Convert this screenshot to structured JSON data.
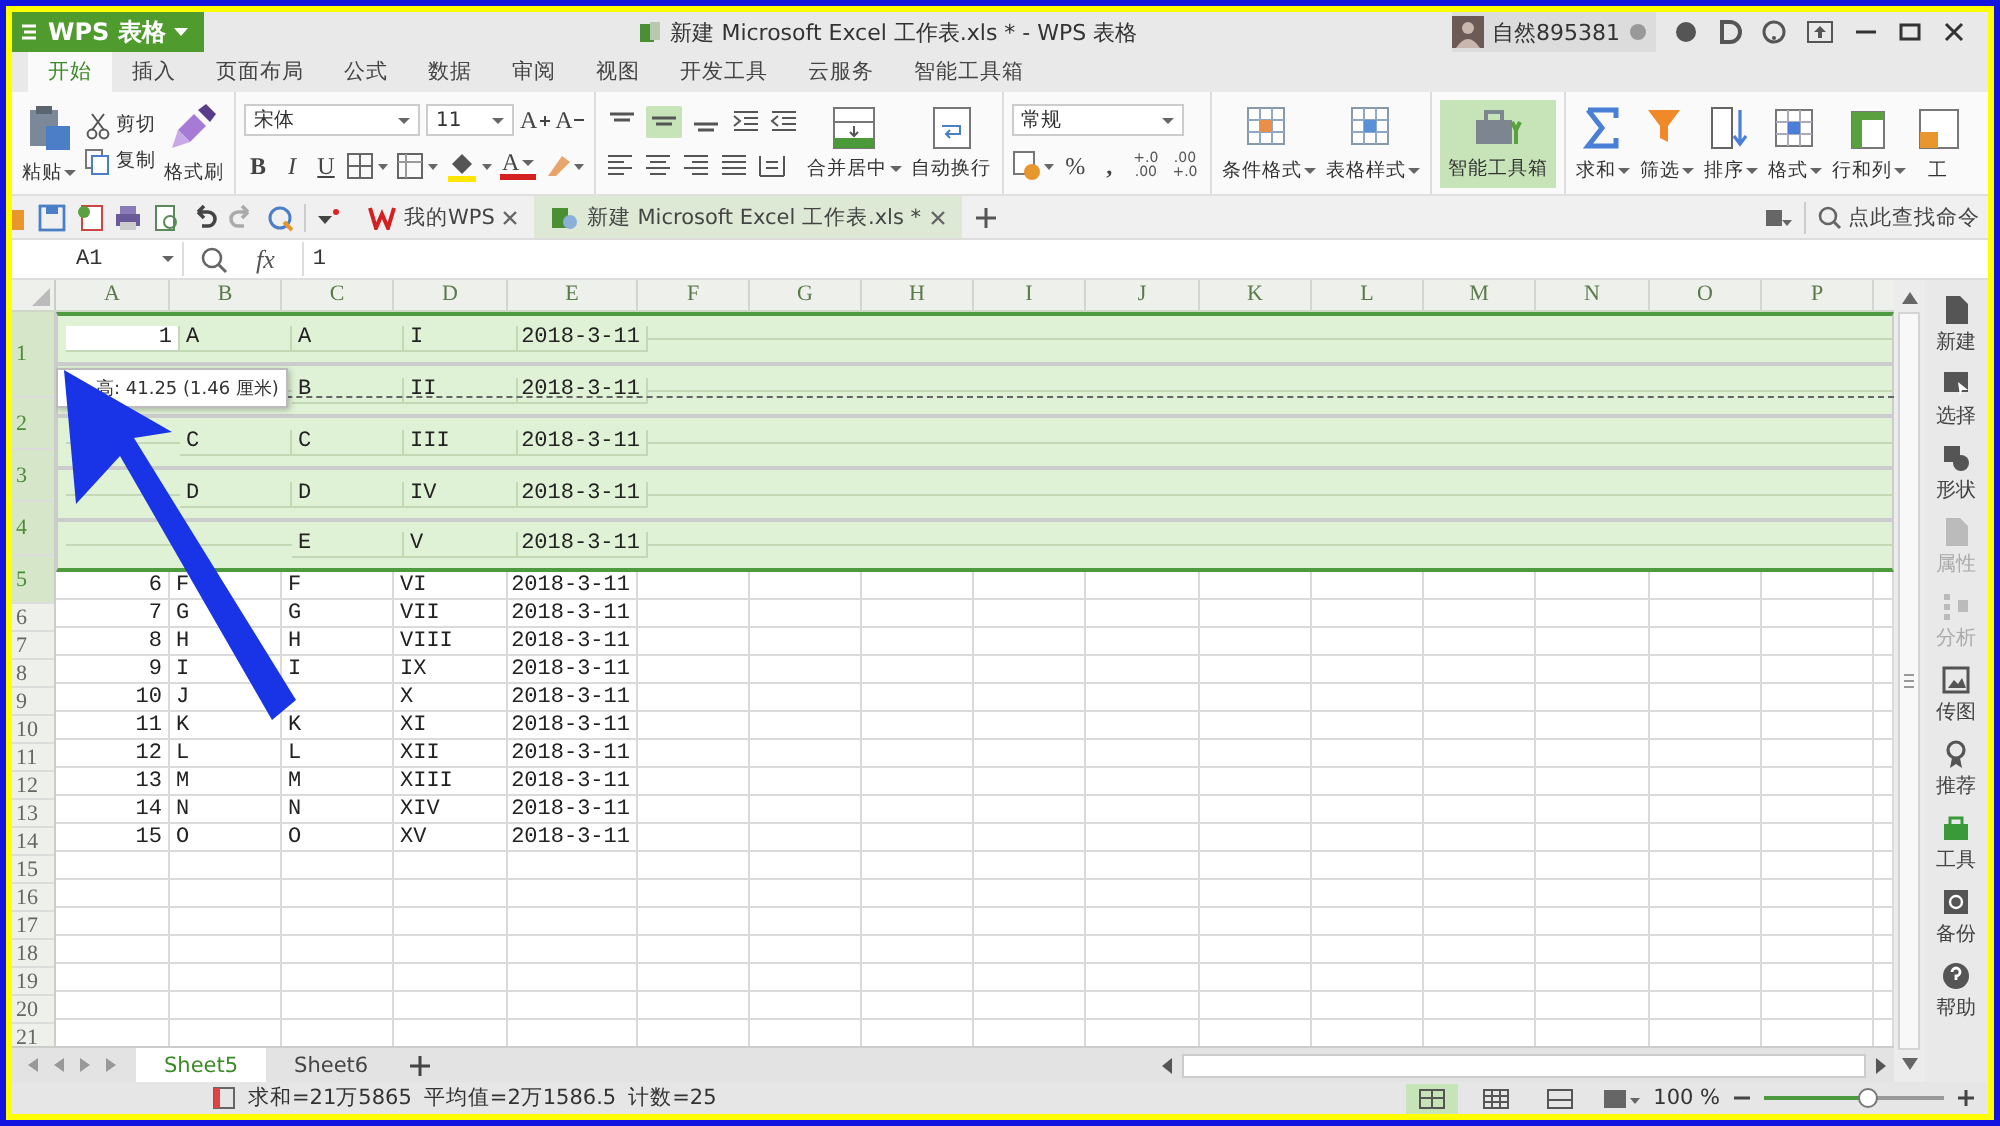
{
  "app_button": {
    "label": "WPS 表格"
  },
  "window": {
    "title": "新建 Microsoft Excel 工作表.xls * - WPS 表格"
  },
  "user": {
    "name": "自然895381"
  },
  "menu_tabs": [
    {
      "label": "开始",
      "selected": true
    },
    {
      "label": "插入",
      "selected": false
    },
    {
      "label": "页面布局",
      "selected": false
    },
    {
      "label": "公式",
      "selected": false
    },
    {
      "label": "数据",
      "selected": false
    },
    {
      "label": "审阅",
      "selected": false
    },
    {
      "label": "视图",
      "selected": false
    },
    {
      "label": "开发工具",
      "selected": false
    },
    {
      "label": "云服务",
      "selected": false
    },
    {
      "label": "智能工具箱",
      "selected": false
    }
  ],
  "ribbon": {
    "clipboard": {
      "paste": "粘贴",
      "cut": "剪切",
      "copy": "复制",
      "format_painter": "格式刷"
    },
    "font": {
      "family": "宋体",
      "size": "11",
      "grow": "A",
      "shrink": "A",
      "bold": "B",
      "italic": "I",
      "underline": "U",
      "font_color": "A"
    },
    "alignment": {
      "valign_buttons": [
        {
          "selected": false
        },
        {
          "selected": true
        },
        {
          "selected": false
        }
      ],
      "merge": "合并居中",
      "wrap": "自动换行"
    },
    "number": {
      "format": "常规",
      "percent": "%",
      "thousands": ",",
      "decimal_buttons": [
        {
          "top": "+.0",
          "bottom": ".00"
        },
        {
          "top": ".00",
          "bottom": "+.0"
        }
      ]
    },
    "styles": [
      {
        "label": "条件格式"
      },
      {
        "label": "表格样式"
      }
    ],
    "toolbox": {
      "label": "智能工具箱",
      "selected": true
    },
    "editing": [
      {
        "label": "求和"
      },
      {
        "label": "筛选"
      },
      {
        "label": "排序"
      },
      {
        "label": "格式"
      },
      {
        "label": "行和列"
      },
      {
        "label": "工"
      }
    ]
  },
  "doc_tabs": [
    {
      "label": "我的WPS",
      "selected": false
    },
    {
      "label": "新建 Microsoft Excel 工作表.xls *",
      "selected": true
    }
  ],
  "command_search": {
    "placeholder": "点此查找命令"
  },
  "formula_bar": {
    "name_box": "A1",
    "fx_label": "fx",
    "value": "1"
  },
  "sheet": {
    "columns": [
      "A",
      "B",
      "C",
      "D",
      "E",
      "F",
      "G",
      "H",
      "I",
      "J",
      "K",
      "L",
      "M",
      "N",
      "O",
      "P"
    ],
    "row_headers": [
      {
        "label": "1",
        "selected": true
      },
      {
        "label": "2",
        "selected": true
      },
      {
        "label": "3",
        "selected": true
      },
      {
        "label": "4",
        "selected": true
      },
      {
        "label": "5",
        "selected": true
      },
      {
        "label": "6",
        "selected": false
      },
      {
        "label": "7",
        "selected": false
      },
      {
        "label": "8",
        "selected": false
      },
      {
        "label": "9",
        "selected": false
      },
      {
        "label": "10",
        "selected": false
      },
      {
        "label": "11",
        "selected": false
      },
      {
        "label": "12",
        "selected": false
      },
      {
        "label": "13",
        "selected": false
      },
      {
        "label": "14",
        "selected": false
      },
      {
        "label": "15",
        "selected": false
      },
      {
        "label": "16",
        "selected": false
      },
      {
        "label": "17",
        "selected": false
      },
      {
        "label": "18",
        "selected": false
      },
      {
        "label": "19",
        "selected": false
      },
      {
        "label": "20",
        "selected": false
      },
      {
        "label": "21",
        "selected": false
      }
    ],
    "rows": [
      {
        "selected": true,
        "cells": [
          {
            "text": "1",
            "active": true
          },
          "A",
          "A",
          "I",
          "2018-3-11"
        ]
      },
      {
        "selected": true,
        "cells": [
          null,
          null,
          "B",
          "II",
          "2018-3-11"
        ]
      },
      {
        "selected": true,
        "cells": [
          null,
          "C",
          "C",
          "III",
          "2018-3-11"
        ]
      },
      {
        "selected": true,
        "cells": [
          null,
          "D",
          "D",
          "IV",
          "2018-3-11"
        ]
      },
      {
        "selected": true,
        "cells": [
          null,
          null,
          "E",
          "V",
          "2018-3-11"
        ]
      },
      {
        "selected": false,
        "cells": [
          "6",
          "F",
          "F",
          "VI",
          "2018-3-11"
        ]
      },
      {
        "selected": false,
        "cells": [
          "7",
          "G",
          "G",
          "VII",
          "2018-3-11"
        ]
      },
      {
        "selected": false,
        "cells": [
          "8",
          "H",
          "H",
          "VIII",
          "2018-3-11"
        ]
      },
      {
        "selected": false,
        "cells": [
          "9",
          "I",
          "I",
          "IX",
          "2018-3-11"
        ]
      },
      {
        "selected": false,
        "cells": [
          "10",
          "J",
          null,
          "X",
          "2018-3-11"
        ]
      },
      {
        "selected": false,
        "cells": [
          "11",
          "K",
          "K",
          "XI",
          "2018-3-11"
        ]
      },
      {
        "selected": false,
        "cells": [
          "12",
          "L",
          "L",
          "XII",
          "2018-3-11"
        ]
      },
      {
        "selected": false,
        "cells": [
          "13",
          "M",
          "M",
          "XIII",
          "2018-3-11"
        ]
      },
      {
        "selected": false,
        "cells": [
          "14",
          "N",
          "N",
          "XIV",
          "2018-3-11"
        ]
      },
      {
        "selected": false,
        "cells": [
          "15",
          "O",
          "O",
          "XV",
          "2018-3-11"
        ]
      }
    ],
    "tooltip": "高: 41.25 (1.46 厘米)"
  },
  "sheet_tabs": [
    {
      "label": "Sheet5",
      "selected": true
    },
    {
      "label": "Sheet6",
      "selected": false
    }
  ],
  "sidebar": [
    {
      "label": "新建",
      "disabled": false
    },
    {
      "label": "选择",
      "disabled": false
    },
    {
      "label": "形状",
      "disabled": false
    },
    {
      "label": "属性",
      "disabled": true
    },
    {
      "label": "分析",
      "disabled": true
    },
    {
      "label": "传图",
      "disabled": false
    },
    {
      "label": "推荐",
      "disabled": false
    },
    {
      "label": "工具",
      "disabled": false
    },
    {
      "label": "备份",
      "disabled": false
    },
    {
      "label": "帮助",
      "disabled": false
    }
  ],
  "status_bar": {
    "items": [
      "求和=21万5865",
      "平均值=2万1586.5",
      "计数=25"
    ],
    "view_modes": [
      {
        "selected": true
      },
      {
        "selected": false
      },
      {
        "selected": false
      }
    ],
    "zoom": "100 %",
    "zoom_slider": {
      "level": 0.58
    }
  }
}
